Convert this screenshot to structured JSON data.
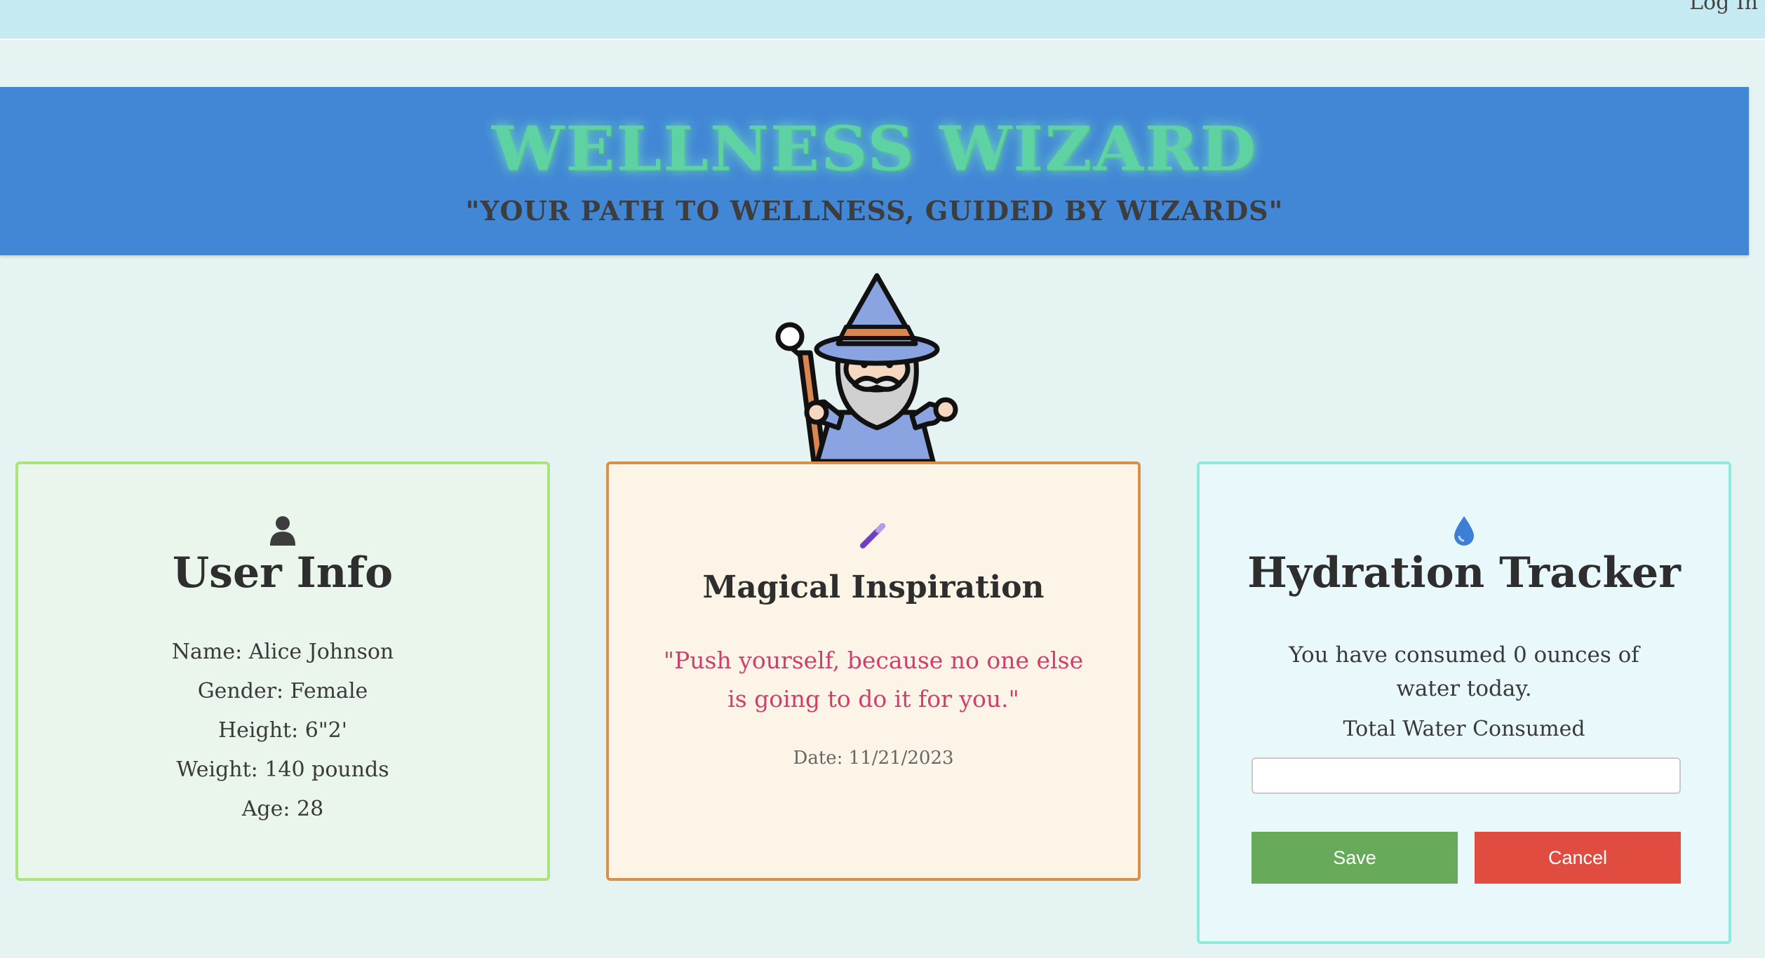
{
  "topbar": {
    "login_label": "Log In"
  },
  "banner": {
    "title": "WELLNESS WIZARD",
    "subtitle": "\"YOUR PATH TO WELLNESS, GUIDED BY WIZARDS\""
  },
  "user_info": {
    "icon": "user-icon",
    "title": "User Info",
    "name": "Name: Alice Johnson",
    "gender": "Gender: Female",
    "height": "Height: 6\"2'",
    "weight": "Weight: 140 pounds",
    "age": "Age: 28"
  },
  "inspiration": {
    "icon": "magic-wand-icon",
    "title": "Magical Inspiration",
    "quote": "\"Push yourself, because no one else is going to do it for you.\"",
    "date": "Date: 11/21/2023"
  },
  "hydration": {
    "icon": "water-drop-icon",
    "title": "Hydration Tracker",
    "status": "You have consumed 0 ounces of water today.",
    "input_label": "Total Water Consumed",
    "input_value": "",
    "save_label": "Save",
    "cancel_label": "Cancel"
  },
  "colors": {
    "banner_bg": "#4287d6",
    "title_green": "#5fd2a3",
    "quote_pink": "#d03f6b",
    "save_green": "#67ab5a",
    "cancel_red": "#e04d40"
  }
}
